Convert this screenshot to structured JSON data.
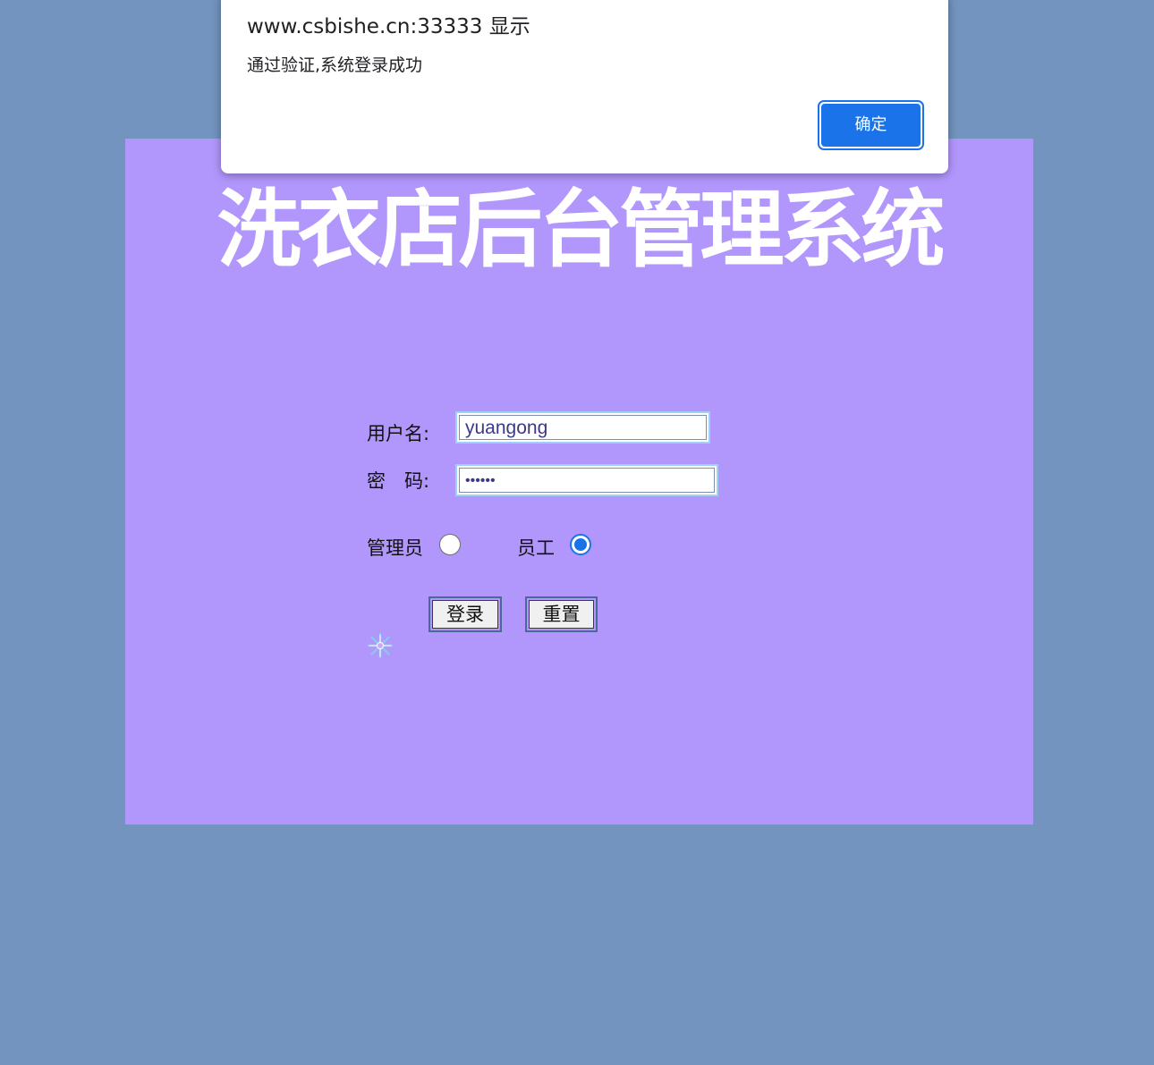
{
  "page": {
    "background_color": "#7294bf",
    "panel_color": "#b197fc"
  },
  "title": "洗衣店后台管理系统",
  "form": {
    "username_label": "用户名:",
    "username_value": "yuangong",
    "password_label": "密　码:",
    "password_display": "••••••",
    "role_admin_label": "管理员",
    "role_staff_label": "员工",
    "role_selected": "员工",
    "login_button": "登录",
    "reset_button": "重置"
  },
  "loading_icon": "snowflake-spinner-icon",
  "dialog": {
    "title": "www.csbishe.cn:33333 显示",
    "message": "通过验证,系统登录成功",
    "ok_button": "确定",
    "accent_color": "#1a73e8"
  }
}
